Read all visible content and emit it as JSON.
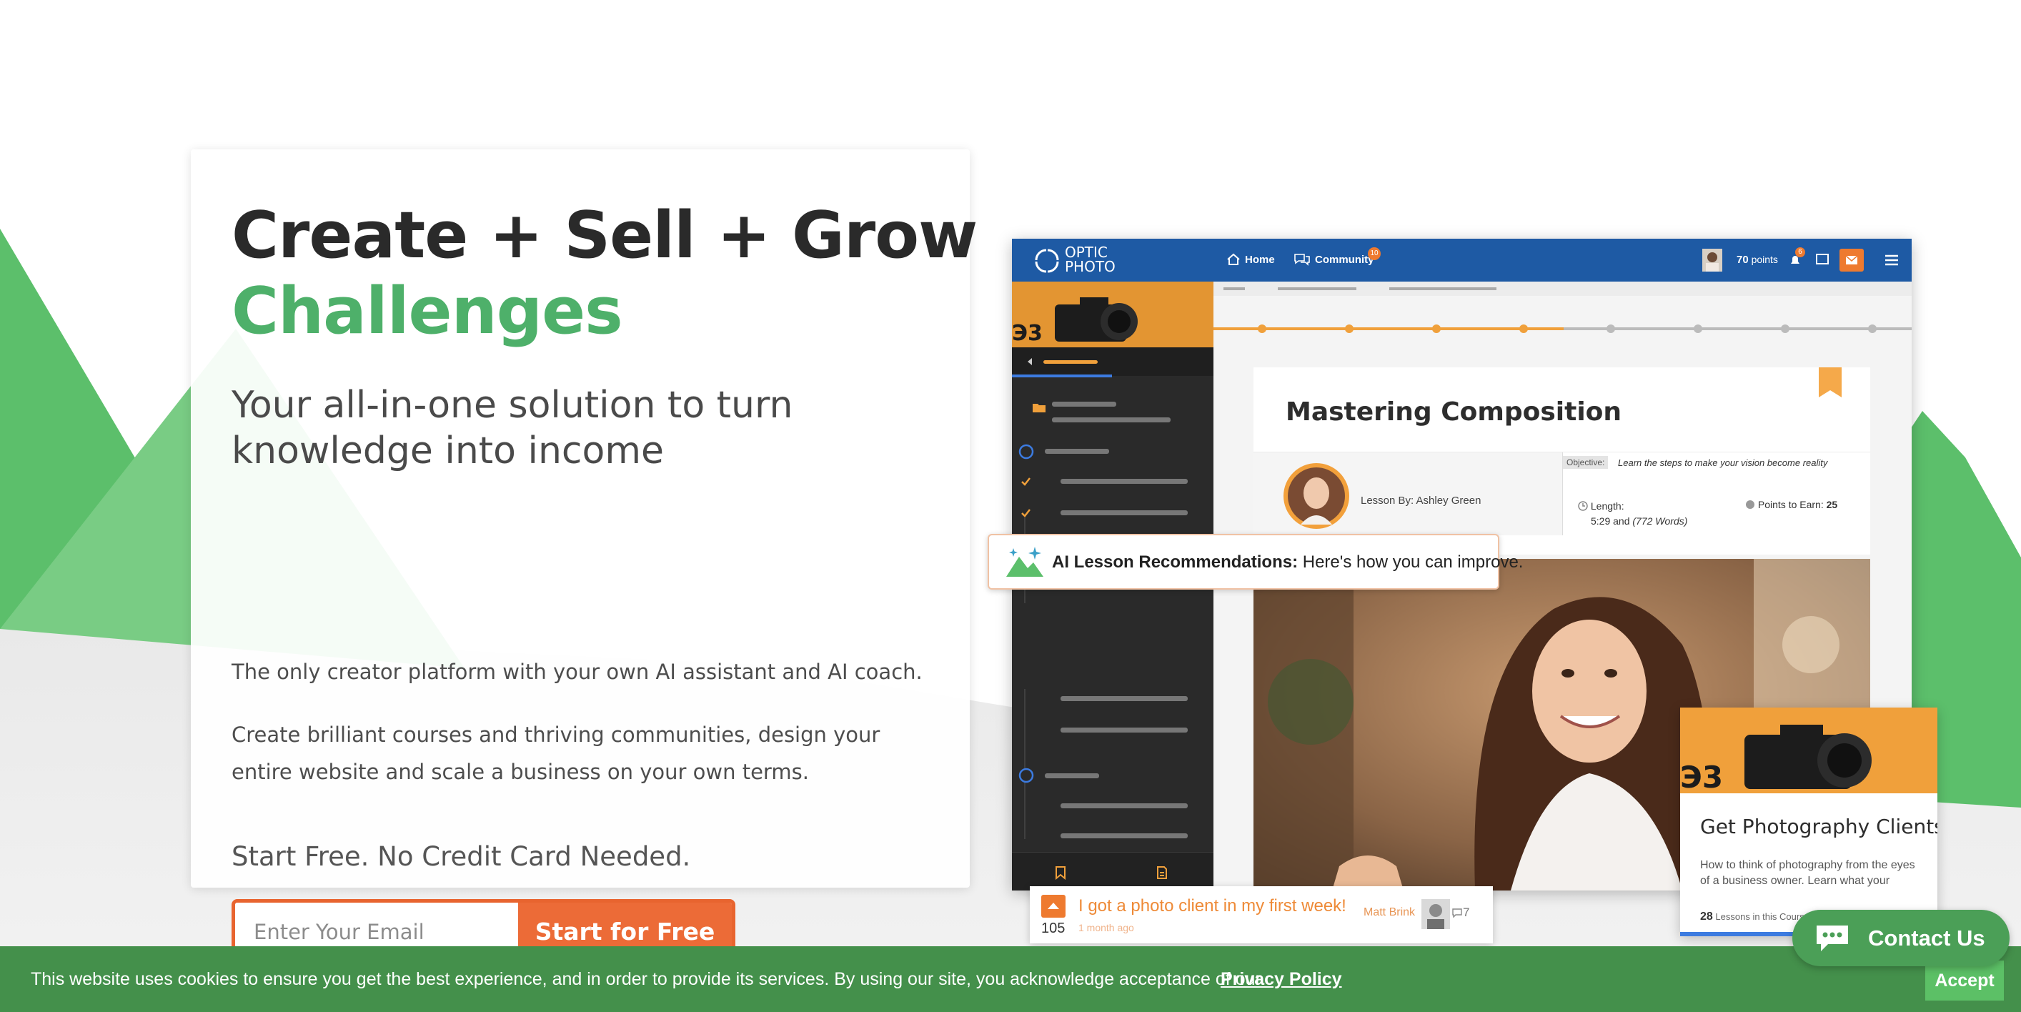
{
  "hero": {
    "title_line1": "Create + Sell + Grow",
    "title_line2": "Challenges",
    "subtitle": "Your all-in-one solution to turn knowledge into income",
    "paragraph1": "The only creator platform with your own AI assistant and AI coach.",
    "paragraph2": "Create brilliant courses and thriving communities, design your entire website and scale a business on your own terms.",
    "start_free": "Start Free. No Credit Card Needed.",
    "email_placeholder": "Enter Your Email",
    "cta_label": "Start for Free"
  },
  "mockup": {
    "logo_line1": "OPTIC",
    "logo_line2": "PHOTO",
    "nav_home": "Home",
    "nav_community": "Community",
    "community_badge": "10",
    "notification_badge": "6",
    "points_value": "70",
    "points_label": "points",
    "lesson_title": "Mastering Composition",
    "lesson_by": "Lesson By: Ashley Green",
    "objective_label": "Objective:",
    "objective_text": "Learn the steps to make your vision become reality",
    "length_label": "Length:",
    "length_value": "5:29 and",
    "length_words": "(772 Words)",
    "points_to_earn_label": "Points to Earn:",
    "points_to_earn_value": "25"
  },
  "ai_banner": {
    "bold": "AI Lesson Recommendations:",
    "text": "Here's how you can improve."
  },
  "course_card": {
    "title": "Get Photography Clients",
    "description": "How to think of photography from the eyes of a business owner. Learn what your",
    "lesson_count": "28",
    "lesson_label": "Lessons in this Course"
  },
  "post": {
    "title": "I got a photo client in my first week!",
    "votes": "105",
    "time_ago": "1 month ago",
    "author": "Matt Brink",
    "comment_count": "7"
  },
  "contact": {
    "label": "Contact Us"
  },
  "cookie": {
    "text": "This website uses cookies to ensure you get the best experience, and in order to provide its services. By using our site, you acknowledge acceptance of our",
    "link": "Privacy Policy",
    "accept": "Accept"
  },
  "colors": {
    "brand_green": "#4eb06a",
    "accent_orange": "#ec6b37",
    "mock_nav_blue": "#1e5aa4",
    "cookie_green": "#44904b"
  }
}
